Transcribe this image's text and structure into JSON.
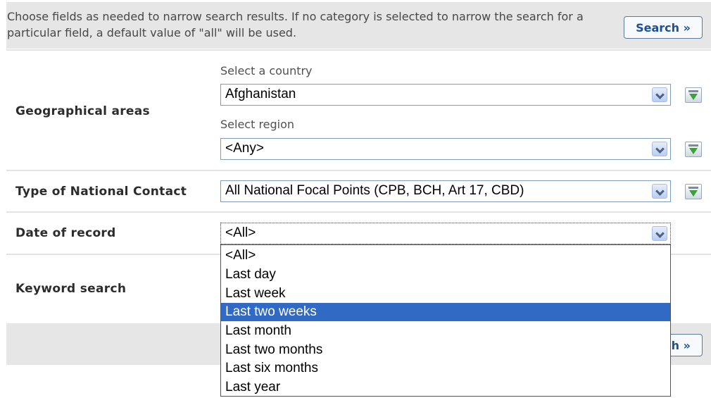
{
  "intro_text": "Choose fields as needed to narrow search results. If no category is selected to narrow the search for a particular field, a default value of \"all\" will be used.",
  "search_label": "Search »",
  "geo": {
    "label": "Geographical areas",
    "country_label": "Select a country",
    "country_value": "Afghanistan",
    "region_label": "Select region",
    "region_value": "<Any>"
  },
  "contact": {
    "label": "Type of National Contact",
    "value": "All National Focal Points (CPB, BCH, Art 17, CBD)"
  },
  "date": {
    "label": "Date of record",
    "value": "<All>",
    "options": [
      "<All>",
      "Last day",
      "Last week",
      "Last two weeks",
      "Last month",
      "Last two months",
      "Last six months",
      "Last year"
    ],
    "highlighted": "Last two weeks"
  },
  "keyword": {
    "label": "Keyword search"
  },
  "icons": {
    "download": "download-arrow-icon",
    "dropdown": "chevron-down-icon"
  }
}
